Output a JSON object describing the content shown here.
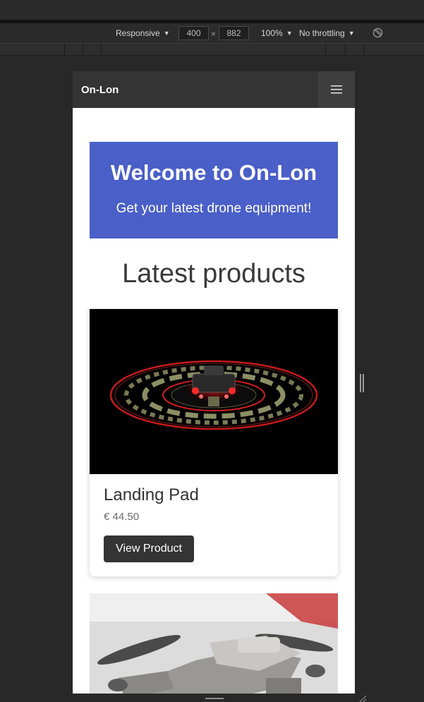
{
  "devtools": {
    "device_label": "Responsive",
    "width_value": "400",
    "height_value": "882",
    "dim_separator": "×",
    "zoom_label": "100%",
    "throttle_label": "No throttling",
    "caret": "▼"
  },
  "site": {
    "brand": "On-Lon",
    "hero": {
      "title": "Welcome to On-Lon",
      "subtitle": "Get your latest drone equipment!"
    },
    "section_title": "Latest products",
    "products": [
      {
        "name": "Landing Pad",
        "price": "€ 44.50",
        "button_label": "View Product",
        "image_icon": "landing-pad-photo"
      },
      {
        "image_icon": "drone-photo"
      }
    ]
  },
  "colors": {
    "hero_bg": "#4a5fc8",
    "navbar_bg": "#343434",
    "button_bg": "#343434"
  }
}
